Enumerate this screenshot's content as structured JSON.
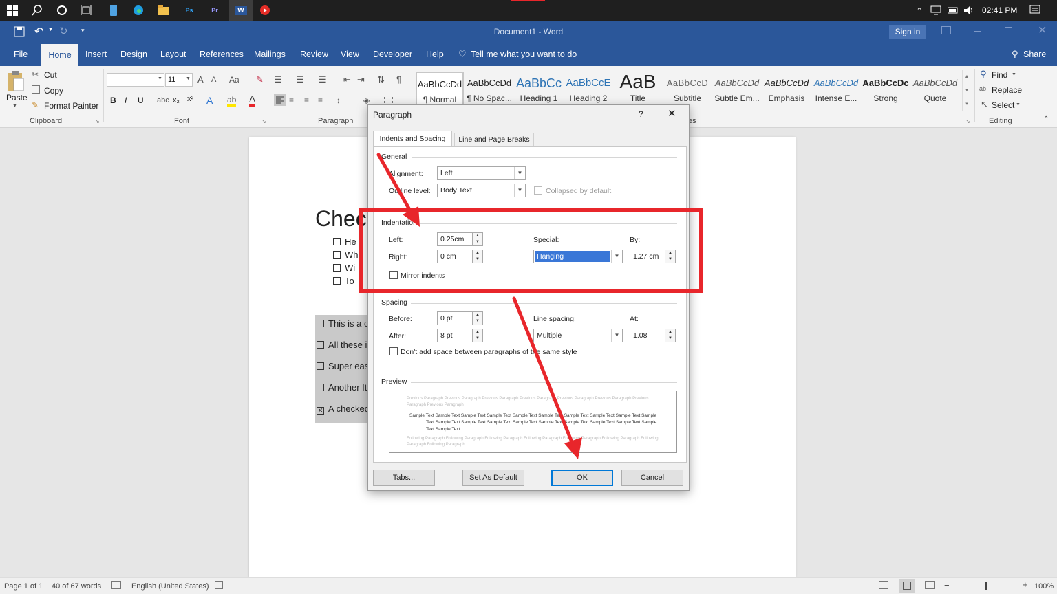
{
  "taskbar": {
    "time": "02:41 PM",
    "app_icons": [
      "windows-start-icon",
      "search-icon",
      "cortana-icon",
      "task-view-icon",
      "phone-icon",
      "edge-icon",
      "file-explorer-icon",
      "photoshop-icon",
      "premiere-icon",
      "word-icon",
      "youtube-icon"
    ],
    "photoshop_label": "Ps",
    "premiere_label": "Pr",
    "word_label": "W"
  },
  "titlebar": {
    "title": "Document1 - Word",
    "sign_in": "Sign in"
  },
  "tabs": [
    "File",
    "Home",
    "Insert",
    "Design",
    "Layout",
    "References",
    "Mailings",
    "Review",
    "View",
    "Developer",
    "Help"
  ],
  "active_tab": "Home",
  "tell_me": "Tell me what you want to do",
  "share": "Share",
  "clipboard": {
    "paste": "Paste",
    "cut": "Cut",
    "copy": "Copy",
    "format_painter": "Format Painter",
    "label": "Clipboard"
  },
  "font": {
    "size": "11",
    "label": "Font",
    "bold": "B",
    "italic": "I",
    "underline": "U",
    "strike": "abc",
    "sub": "x₂",
    "sup": "x²"
  },
  "paragraph_group": {
    "label": "Paragraph",
    "pilcrow": "¶"
  },
  "styles": [
    {
      "sample": "AaBbCcDd",
      "name": "¶ Normal"
    },
    {
      "sample": "AaBbCcDd",
      "name": "¶ No Spac..."
    },
    {
      "sample": "AaBbCc",
      "name": "Heading 1"
    },
    {
      "sample": "AaBbCcE",
      "name": "Heading 2"
    },
    {
      "sample": "AaB",
      "name": "Title"
    },
    {
      "sample": "AaBbCcD",
      "name": "Subtitle"
    },
    {
      "sample": "AaBbCcDd",
      "name": "Subtle Em..."
    },
    {
      "sample": "AaBbCcDd",
      "name": "Emphasis"
    },
    {
      "sample": "AaBbCcDd",
      "name": "Intense E..."
    },
    {
      "sample": "AaBbCcDc",
      "name": "Strong"
    },
    {
      "sample": "AaBbCcDd",
      "name": "Quote"
    }
  ],
  "styles_group_label_tail": "es",
  "editing": {
    "find": "Find",
    "replace": "Replace",
    "select": "Select",
    "label": "Editing"
  },
  "document": {
    "heading_partial": "Chec",
    "list_items": [
      "He",
      "Wh",
      "Wi",
      "To"
    ],
    "shaded_items": [
      {
        "text": "This is a c",
        "checked": false
      },
      {
        "text": "All these i",
        "checked": false
      },
      {
        "text": "Super eas",
        "checked": false
      },
      {
        "text": "Another It",
        "checked": false
      },
      {
        "text": "A checked",
        "checked": true
      }
    ]
  },
  "dialog": {
    "title": "Paragraph",
    "help": "?",
    "tabs": [
      "Indents and Spacing",
      "Line and Page Breaks"
    ],
    "general": {
      "section": "General",
      "alignment_label": "Alignment:",
      "alignment_value": "Left",
      "outline_label": "Outline level:",
      "outline_value": "Body Text",
      "collapsed_label": "Collapsed by default"
    },
    "indentation": {
      "section": "Indentation",
      "left_label": "Left:",
      "left_value": "0.25cm",
      "right_label": "Right:",
      "right_value": "0 cm",
      "special_label": "Special:",
      "special_value": "Hanging",
      "by_label": "By:",
      "by_value": "1.27 cm",
      "mirror_label": "Mirror indents"
    },
    "spacing": {
      "section": "Spacing",
      "before_label": "Before:",
      "before_value": "0 pt",
      "after_label": "After:",
      "after_value": "8 pt",
      "line_spacing_label": "Line spacing:",
      "line_spacing_value": "Multiple",
      "at_label": "At:",
      "at_value": "1.08",
      "dont_add_label": "Don't add space between paragraphs of the same style"
    },
    "preview": {
      "section": "Preview",
      "previous": "Previous Paragraph Previous Paragraph Previous Paragraph Previous Paragraph Previous Paragraph Previous Paragraph Previous Paragraph Previous Paragraph",
      "sample": "Sample Text Sample Text Sample Text Sample Text Sample Text Sample Text Sample Text Sample Text Sample Text Sample Text Sample Text Sample Text Sample Text Sample Text Sample Text Sample Text Sample Text Sample Text Sample Text Sample Text",
      "following": "Following Paragraph Following Paragraph Following Paragraph Following Paragraph Following Paragraph Following Paragraph Following Paragraph Following Paragraph"
    },
    "buttons": {
      "tabs": "Tabs...",
      "set_default": "Set As Default",
      "ok": "OK",
      "cancel": "Cancel"
    }
  },
  "statusbar": {
    "page": "Page 1 of 1",
    "words": "40 of 67 words",
    "language": "English (United States)",
    "zoom": "100%"
  },
  "colors": {
    "word_blue": "#2b579a",
    "highlight_red": "#e8262b",
    "selection_blue": "#3a77d7"
  }
}
